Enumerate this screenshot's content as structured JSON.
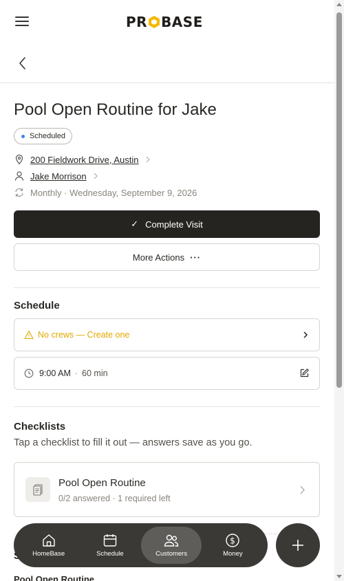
{
  "header": {
    "logo_before": "PR",
    "logo_after": "BASE",
    "menu_icon": "hamburger-menu-icon",
    "back_icon": "chevron-left-icon"
  },
  "visit": {
    "title": "Pool Open Routine for Jake",
    "status": "Scheduled",
    "status_color": "#3b82f6",
    "address": "200 Fieldwork Drive, Austin",
    "customer": "Jake Morrison",
    "recurrence": "Monthly · Wednesday, September 9, 2026"
  },
  "actions": {
    "complete_label": "Complete Visit",
    "more_label": "More Actions"
  },
  "schedule": {
    "title": "Schedule",
    "crew_warning": "No crews — Create one",
    "warning_color": "#e0a800",
    "time": "9:00 AM",
    "separator": "·",
    "duration": "60 min"
  },
  "checklists": {
    "title": "Checklists",
    "subtitle": "Tap a checklist to fill it out — answers save as you go.",
    "items": [
      {
        "name": "Pool Open Routine",
        "status": "0/2 answered · 1 required left"
      }
    ]
  },
  "peek": {
    "section_letter": "S",
    "text": "Pool Open Routine"
  },
  "nav": {
    "items": [
      {
        "label": "HomeBase",
        "icon": "home-icon"
      },
      {
        "label": "Schedule",
        "icon": "calendar-icon"
      },
      {
        "label": "Customers",
        "icon": "users-icon",
        "active": true
      },
      {
        "label": "Money",
        "icon": "dollar-icon"
      }
    ],
    "fab_icon": "plus-icon"
  },
  "colors": {
    "primary_button": "#262421",
    "nav_bg": "#3a3936",
    "nav_active": "#5e5d5a"
  }
}
